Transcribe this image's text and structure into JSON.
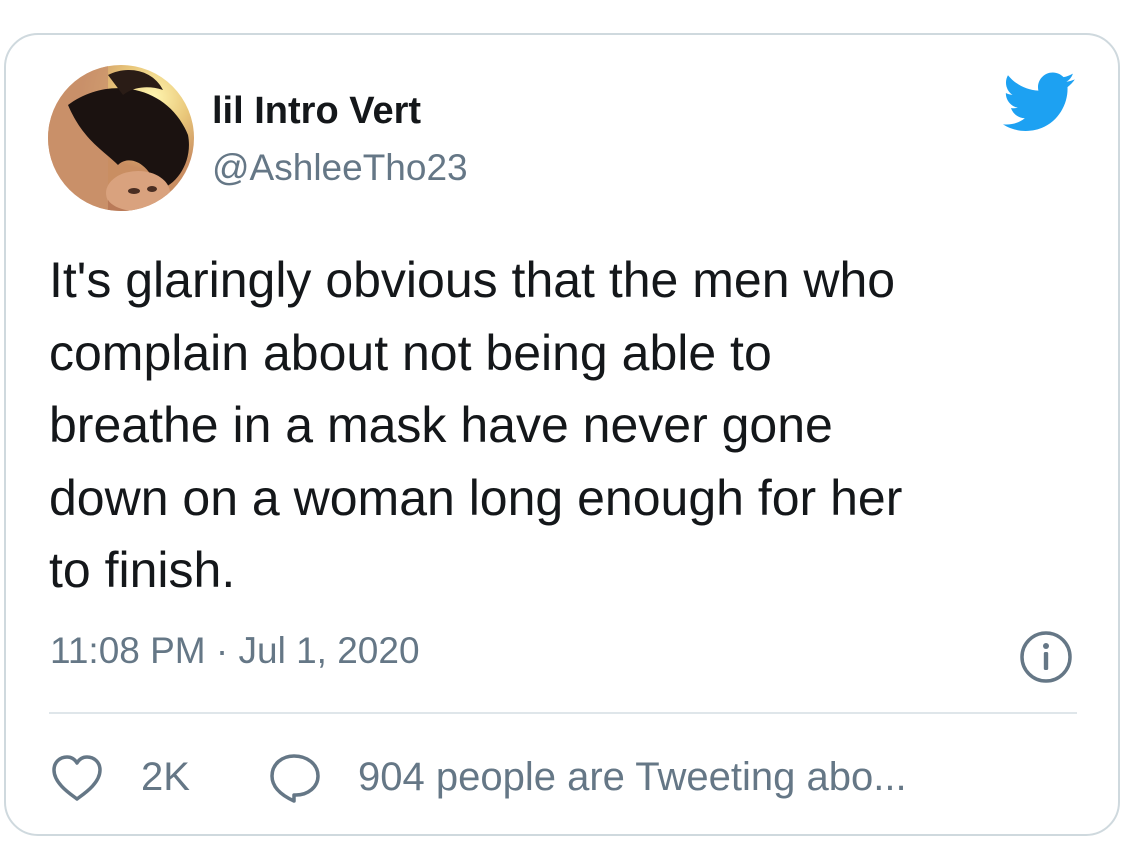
{
  "user": {
    "display_name": "lil Intro Vert",
    "handle": "@AshleeTho23",
    "avatar_icon": "user-avatar-photo"
  },
  "tweet": {
    "lines": [
      "It's glaringly obvious that the men who",
      "complain about not being able to",
      "breathe in a mask have never gone",
      "down on a woman long enough for her",
      "to finish."
    ]
  },
  "meta": {
    "timestamp": "11:08 PM · Jul 1, 2020"
  },
  "actions": {
    "like_count": "2K",
    "conversation_text": "904 people are Tweeting abo..."
  },
  "icons": {
    "brand": "twitter-bird-icon",
    "info": "info-icon",
    "like": "heart-icon",
    "reply": "speech-bubble-icon"
  },
  "colors": {
    "brand_blue": "#1da1f2",
    "text_primary": "#14171a",
    "text_secondary": "#657786",
    "border": "#cfd9de"
  }
}
